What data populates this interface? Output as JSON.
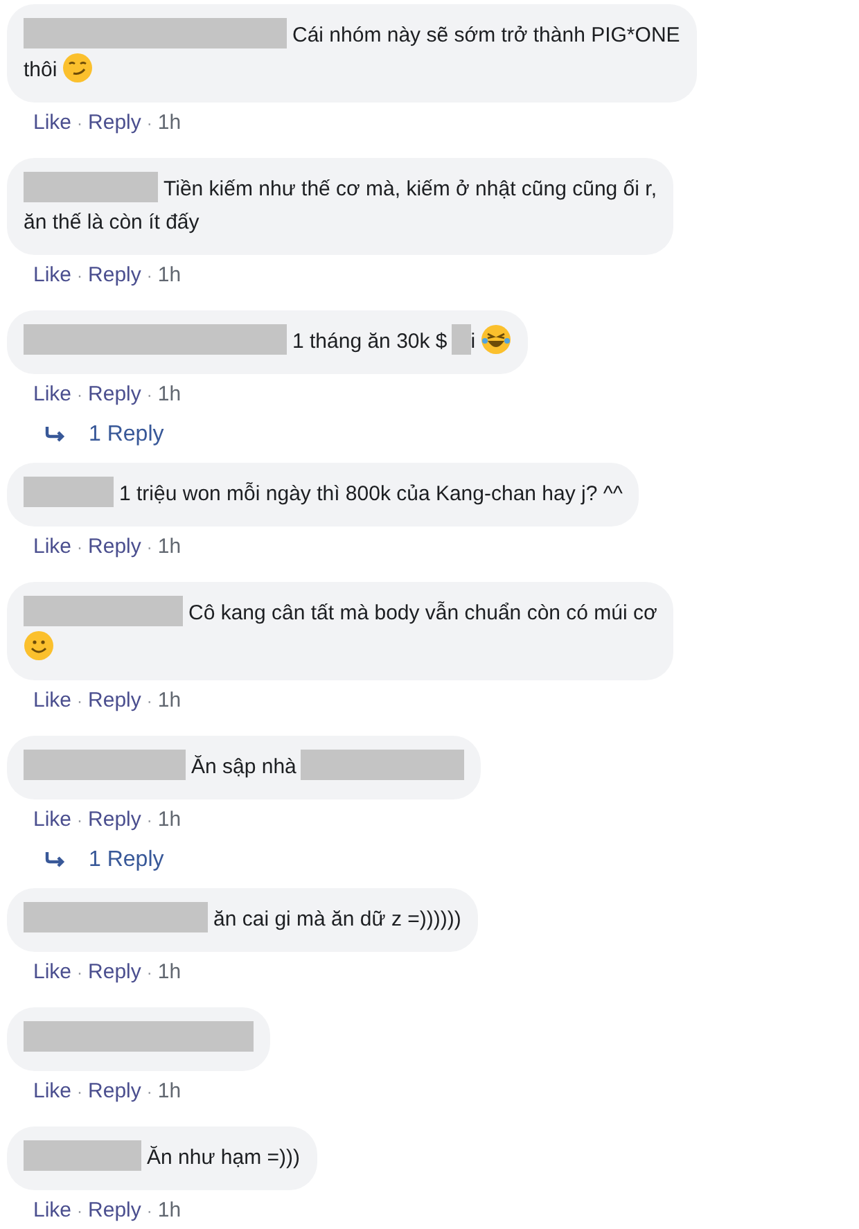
{
  "comments": [
    {
      "parts": [
        {
          "kind": "redacted"
        },
        {
          "kind": "text",
          "text": "Cái nhóm này sẽ sớm trở thành PIG*ONE"
        },
        {
          "kind": "break"
        },
        {
          "kind": "text",
          "text": "thôi"
        },
        {
          "kind": "smirk"
        }
      ],
      "meta": [
        {
          "kind": "link",
          "text": "Like"
        },
        {
          "kind": "sep",
          "text": "·"
        },
        {
          "kind": "link",
          "text": "Reply"
        },
        {
          "kind": "sep",
          "text": "·"
        },
        {
          "kind": "time",
          "text": "1h"
        }
      ]
    },
    {
      "parts": [
        {
          "kind": "redacted"
        },
        {
          "kind": "text",
          "text": "Tiền kiếm như thế cơ mà, kiếm ở nhật cũng cũng ối r,"
        },
        {
          "kind": "break"
        },
        {
          "kind": "text",
          "text": "ăn thế là còn ít đấy"
        }
      ],
      "meta": [
        {
          "kind": "link",
          "text": "Like"
        },
        {
          "kind": "sep",
          "text": "·"
        },
        {
          "kind": "link",
          "text": "Reply"
        },
        {
          "kind": "sep",
          "text": "·"
        },
        {
          "kind": "time",
          "text": "1h"
        }
      ]
    },
    {
      "parts": [
        {
          "kind": "redacted"
        },
        {
          "kind": "text",
          "text": "1 tháng ăn 30k $"
        },
        {
          "kind": "redacted"
        },
        {
          "kind": "text",
          "text": "i"
        },
        {
          "kind": "laugh"
        }
      ],
      "meta": [
        {
          "kind": "link",
          "text": "Like"
        },
        {
          "kind": "sep",
          "text": "·"
        },
        {
          "kind": "link",
          "text": "Reply"
        },
        {
          "kind": "sep",
          "text": "·"
        },
        {
          "kind": "time",
          "text": "1h"
        }
      ],
      "replies_link": "1 Reply"
    },
    {
      "parts": [
        {
          "kind": "redacted"
        },
        {
          "kind": "text",
          "text": "1 triệu won mỗi ngày thì 800k của Kang-chan hay j? ^^"
        }
      ],
      "meta": [
        {
          "kind": "link",
          "text": "Like"
        },
        {
          "kind": "sep",
          "text": "·"
        },
        {
          "kind": "link",
          "text": "Reply"
        },
        {
          "kind": "sep",
          "text": "·"
        },
        {
          "kind": "time",
          "text": "1h"
        }
      ]
    },
    {
      "parts": [
        {
          "kind": "redacted"
        },
        {
          "kind": "text",
          "text": "Cô kang cân tất mà body vẫn chuẩn còn có múi cơ"
        },
        {
          "kind": "break"
        },
        {
          "kind": "smile"
        }
      ],
      "meta": [
        {
          "kind": "link",
          "text": "Like"
        },
        {
          "kind": "sep",
          "text": "·"
        },
        {
          "kind": "link",
          "text": "Reply"
        },
        {
          "kind": "sep",
          "text": "·"
        },
        {
          "kind": "time",
          "text": "1h"
        }
      ]
    },
    {
      "parts": [
        {
          "kind": "redacted"
        },
        {
          "kind": "text",
          "text": "Ăn sập nhà"
        },
        {
          "kind": "redacted"
        }
      ],
      "meta": [
        {
          "kind": "link",
          "text": "Like"
        },
        {
          "kind": "sep",
          "text": "·"
        },
        {
          "kind": "link",
          "text": "Reply"
        },
        {
          "kind": "sep",
          "text": "·"
        },
        {
          "kind": "time",
          "text": "1h"
        }
      ],
      "replies_link": "1 Reply"
    },
    {
      "parts": [
        {
          "kind": "redacted"
        },
        {
          "kind": "text",
          "text": "ăn cai gi mà ăn dữ z =))))))"
        }
      ],
      "meta": [
        {
          "kind": "link",
          "text": "Like"
        },
        {
          "kind": "sep",
          "text": "·"
        },
        {
          "kind": "link",
          "text": "Reply"
        },
        {
          "kind": "sep",
          "text": "·"
        },
        {
          "kind": "time",
          "text": "1h"
        }
      ]
    },
    {
      "parts": [
        {
          "kind": "redacted"
        }
      ],
      "meta": [
        {
          "kind": "link",
          "text": "Like"
        },
        {
          "kind": "sep",
          "text": "·"
        },
        {
          "kind": "link",
          "text": "Reply"
        },
        {
          "kind": "sep",
          "text": "·"
        },
        {
          "kind": "time",
          "text": "1h"
        }
      ]
    },
    {
      "parts": [
        {
          "kind": "redacted"
        },
        {
          "kind": "text",
          "text": "Ăn như hạm =)))"
        }
      ],
      "meta": [
        {
          "kind": "link",
          "text": "Like"
        },
        {
          "kind": "sep",
          "text": "·"
        },
        {
          "kind": "link",
          "text": "Reply"
        },
        {
          "kind": "sep",
          "text": "·"
        },
        {
          "kind": "time",
          "text": "1h"
        }
      ]
    }
  ]
}
